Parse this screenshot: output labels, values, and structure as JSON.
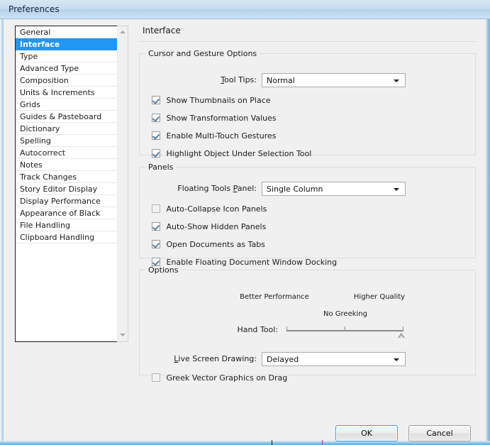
{
  "window": {
    "title": "Preferences"
  },
  "sidebar": {
    "items": [
      {
        "label": "General",
        "selected": false
      },
      {
        "label": "Interface",
        "selected": true
      },
      {
        "label": "Type",
        "selected": false
      },
      {
        "label": "Advanced Type",
        "selected": false
      },
      {
        "label": "Composition",
        "selected": false
      },
      {
        "label": "Units & Increments",
        "selected": false
      },
      {
        "label": "Grids",
        "selected": false
      },
      {
        "label": "Guides & Pasteboard",
        "selected": false
      },
      {
        "label": "Dictionary",
        "selected": false
      },
      {
        "label": "Spelling",
        "selected": false
      },
      {
        "label": "Autocorrect",
        "selected": false
      },
      {
        "label": "Notes",
        "selected": false
      },
      {
        "label": "Track Changes",
        "selected": false
      },
      {
        "label": "Story Editor Display",
        "selected": false
      },
      {
        "label": "Display Performance",
        "selected": false
      },
      {
        "label": "Appearance of Black",
        "selected": false
      },
      {
        "label": "File Handling",
        "selected": false
      },
      {
        "label": "Clipboard Handling",
        "selected": false
      }
    ],
    "scroll_up_icon": "triangle-up-icon",
    "scroll_down_icon": "triangle-down-icon"
  },
  "pane": {
    "title": "Interface",
    "cursor_group": {
      "legend": "Cursor and Gesture Options",
      "tool_tips_label": "Tool Tips:",
      "tool_tips_value": "Normal",
      "checkboxes": [
        {
          "label": "Show Thumbnails on Place",
          "checked": true
        },
        {
          "label": "Show Transformation Values",
          "checked": true
        },
        {
          "label": "Enable Multi-Touch Gestures",
          "checked": true
        },
        {
          "label": "Highlight Object Under Selection Tool",
          "checked": true
        }
      ]
    },
    "panels_group": {
      "legend": "Panels",
      "floating_tools_label": "Floating Tools Panel:",
      "floating_tools_value": "Single Column",
      "checkboxes": [
        {
          "label": "Auto-Collapse Icon Panels",
          "checked": false
        },
        {
          "label": "Auto-Show Hidden Panels",
          "checked": true
        },
        {
          "label": "Open Documents as Tabs",
          "checked": true
        },
        {
          "label": "Enable Floating Document Window Docking",
          "checked": true
        }
      ]
    },
    "options_group": {
      "legend": "Options",
      "hand_tool_label": "Hand Tool:",
      "slider_left_caption": "Better Performance",
      "slider_right_caption": "Higher Quality",
      "slider_mid_caption": "No Greeking",
      "slider_value_percent": 100,
      "live_screen_label": "Live Screen Drawing:",
      "live_screen_value": "Delayed",
      "greek_vector_label": "Greek Vector Graphics on Drag",
      "greek_vector_checked": false
    }
  },
  "footer": {
    "ok_label": "OK",
    "cancel_label": "Cancel"
  },
  "colors": {
    "selection": "#2196f3",
    "dialog_bg": "#f0f0f0",
    "titlebar": "#c6dcef",
    "default_button_border": "#3c9ddb"
  }
}
